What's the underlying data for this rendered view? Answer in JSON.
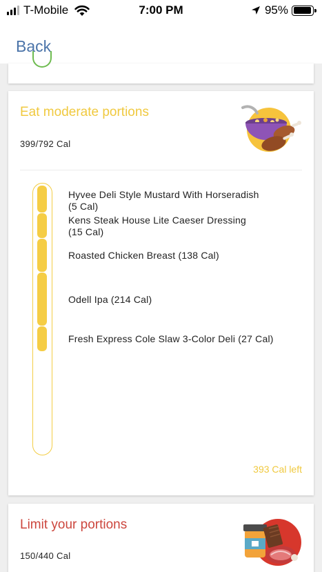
{
  "status_bar": {
    "carrier": "T-Mobile",
    "time": "7:00 PM",
    "battery": "95%",
    "battery_level": 0.95
  },
  "nav": {
    "back_label": "Back"
  },
  "colors": {
    "accent_blue": "#4b74a9",
    "moderate_yellow": "#f3cd45",
    "limit_red": "#cc463d",
    "ok_green": "#6dbb4f"
  },
  "moderate": {
    "title": "Eat moderate portions",
    "summary": "399/792 Cal",
    "icon": "chicken-bowl-icon",
    "items": [
      {
        "name": "Hyvee Deli Style Mustard With Horseradish",
        "cal": "(5 Cal)"
      },
      {
        "name": "Kens Steak House Lite Caeser Dressing",
        "cal": "(15 Cal)"
      },
      {
        "name": "Roasted Chicken Breast (138 Cal)"
      },
      {
        "name": "Odell Ipa (214 Cal)"
      },
      {
        "name": "Fresh Express Cole Slaw 3-Color Deli (27 Cal)"
      }
    ],
    "remaining": "393 Cal left"
  },
  "limit": {
    "title": "Limit your portions",
    "summary": "150/440 Cal",
    "icon": "steak-jar-chocolate-icon"
  }
}
